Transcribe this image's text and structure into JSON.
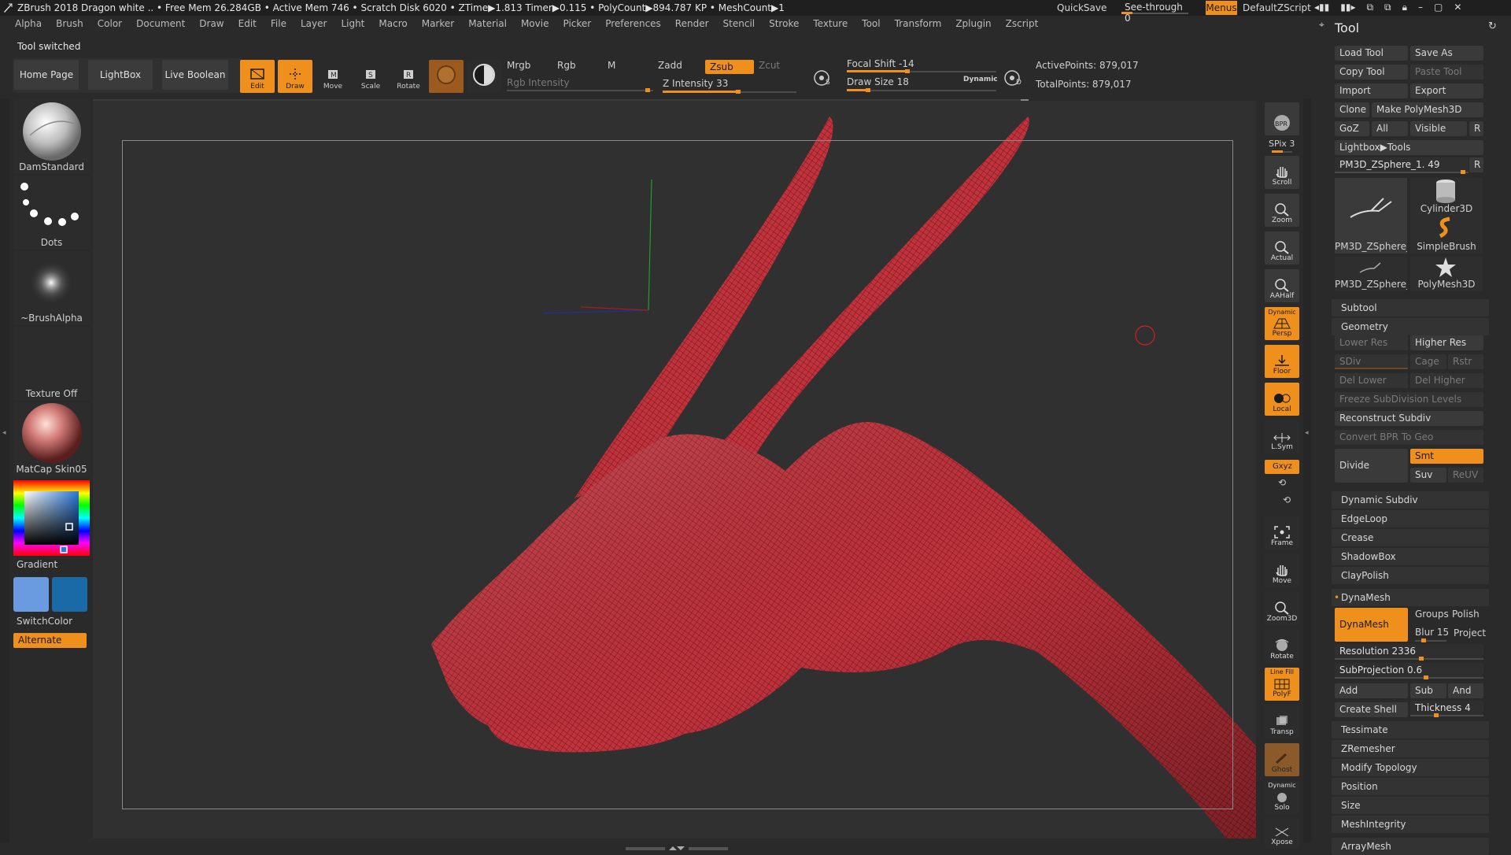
{
  "titlebar": {
    "text": "ZBrush 2018   Dragon white   .. • Free Mem 26.284GB • Active Mem 746 • Scratch Disk 6020 • ZTime▶1.813 Timer▶0.115 • PolyCount▶894.787 KP  • MeshCount▶1",
    "quicksave": "QuickSave",
    "see_through": "See-through  0",
    "see_through_value": 0,
    "menus": "Menus",
    "default_zscript": "DefaultZScript"
  },
  "menubar": [
    "Alpha",
    "Brush",
    "Color",
    "Document",
    "Draw",
    "Edit",
    "File",
    "Layer",
    "Light",
    "Macro",
    "Marker",
    "Material",
    "Movie",
    "Picker",
    "Preferences",
    "Render",
    "Stencil",
    "Stroke",
    "Texture",
    "Tool",
    "Transform",
    "Zplugin",
    "Zscript"
  ],
  "status_message": "Tool switched",
  "topshelf": {
    "home_page": "Home Page",
    "lightbox": "LightBox",
    "live_boolean": "Live Boolean",
    "edit": "Edit",
    "draw": "Draw",
    "move": "Move",
    "scale": "Scale",
    "rotate": "Rotate",
    "mrgb": "Mrgb",
    "rgb": "Rgb",
    "m": "M",
    "rgb_intensity": "Rgb Intensity",
    "zadd": "Zadd",
    "zsub": "Zsub",
    "zcut": "Zcut",
    "z_intensity": "Z Intensity 33",
    "z_intensity_value": 33,
    "focal_shift": "Focal Shift -14",
    "focal_shift_value": -14,
    "draw_size": "Draw Size 18",
    "draw_size_value": 18,
    "dynamic": "Dynamic",
    "active_points": "ActivePoints: 879,017",
    "total_points": "TotalPoints: 879,017"
  },
  "leftshelf": {
    "brush": "DamStandard",
    "stroke": "Dots",
    "alpha": "~BrushAlpha",
    "texture": "Texture Off",
    "material": "MatCap Skin05",
    "gradient": "Gradient",
    "switchcolor": "SwitchColor",
    "alternate": "Alternate",
    "main_color": "#6a9ae0",
    "secondary_color": "#1a6aa8"
  },
  "rightshelf": {
    "bpr": "BPR",
    "spix": "SPix 3",
    "scroll": "Scroll",
    "zoom": "Zoom",
    "actual": "Actual",
    "aahalf": "AAHalf",
    "dynamic_label": "Dynamic",
    "persp": "Persp",
    "floor": "Floor",
    "local": "Local",
    "lsym": "L.Sym",
    "xyz": "Gxyz",
    "frame": "Frame",
    "move": "Move",
    "zoom3d": "Zoom3D",
    "rotate": "Rotate",
    "linefill": "Line Fill",
    "polyf": "PolyF",
    "transp": "Transp",
    "ghost": "Ghost",
    "dynamic2": "Dynamic",
    "solo": "Solo",
    "xpose": "Xpose"
  },
  "tool_panel": {
    "title": "Tool",
    "load_tool": "Load Tool",
    "save_as": "Save As",
    "copy_tool": "Copy Tool",
    "paste_tool": "Paste Tool",
    "import": "Import",
    "export": "Export",
    "clone": "Clone",
    "make_polymesh": "Make PolyMesh3D",
    "goz": "GoZ",
    "all": "All",
    "visible": "Visible",
    "r": "R",
    "lightbox_tools": "Lightbox▶Tools",
    "current_tool": "PM3D_ZSphere_1. 49",
    "tiles": [
      "PM3D_ZSphere_",
      "Cylinder3D",
      "SimpleBrush",
      "PM3D_ZSphere_",
      "PolyMesh3D"
    ],
    "subtool": "Subtool",
    "geometry": "Geometry",
    "lower_res": "Lower Res",
    "higher_res": "Higher Res",
    "sdiv": "SDiv",
    "cage": "Cage",
    "rstr": "Rstr",
    "del_lower": "Del Lower",
    "del_higher": "Del Higher",
    "freeze_subdiv": "Freeze SubDivision Levels",
    "reconstruct_subdiv": "Reconstruct Subdiv",
    "convert_bpr": "Convert BPR To Geo",
    "divide": "Divide",
    "smt": "Smt",
    "suv": "Suv",
    "reuv": "ReUV",
    "sections": [
      "Dynamic Subdiv",
      "EdgeLoop",
      "Crease",
      "ShadowBox",
      "ClayPolish"
    ],
    "dynamesh_header": "DynaMesh",
    "dynamesh_btn": "DynaMesh",
    "groups": "Groups",
    "polish": "Polish",
    "blur": "Blur 15",
    "blur_value": 15,
    "project": "Project",
    "resolution": "Resolution 2336",
    "resolution_value": 2336,
    "subprojection": "SubProjection 0.6",
    "subprojection_value": 0.6,
    "add": "Add",
    "sub": "Sub",
    "and": "And",
    "create_shell": "Create Shell",
    "thickness": "Thickness 4",
    "thickness_value": 4,
    "sections2": [
      "Tessimate",
      "ZRemesher",
      "Modify Topology",
      "Position",
      "Size",
      "MeshIntegrity"
    ],
    "arraymesh": "ArrayMesh"
  },
  "colors": {
    "accent": "#f0901c",
    "mesh": "#c0323c",
    "wire": "#5a0f14"
  }
}
